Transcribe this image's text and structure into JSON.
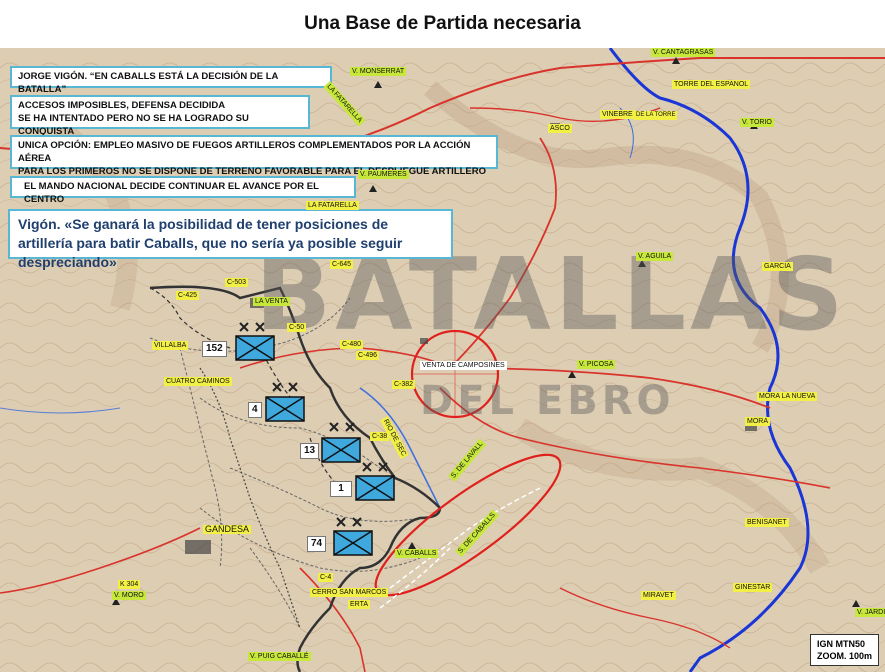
{
  "title": "Una Base de Partida necesaria",
  "info_boxes": {
    "vigon_quote_title": "JORGE VIGÓN. “EN CABALLS ESTÁ LA DECISIÓN DE LA BATALLA”",
    "accesos": "ACCESOS IMPOSIBLES, DEFENSA DECIDIDA\nSE HA INTENTADO PERO NO SE HA LOGRADO SU CONQUISTA",
    "unica_opcion": "UNICA OPCIÓN: EMPLEO MASIVO DE FUEGOS ARTILLEROS COMPLEMENTADOS POR LA ACCIÓN AÉREA\nPARA LOS PRIMEROS NO SE DISPONE DE TERRENO FAVORABLE PARA EL DESPLIEGUE ARTILLERO",
    "mando": "EL MANDO NACIONAL DECIDE CONTINUAR EL AVANCE POR EL CENTRO"
  },
  "quote": "Vigón. «Se ganará la posibilidad de tener posiciones de artillería para batir Caballs, que no sería ya posible seguir despreciando»",
  "watermark": {
    "line1": "BATALLAS",
    "line2": "DEL EBRO"
  },
  "units": [
    {
      "number": "152"
    },
    {
      "number": "4"
    },
    {
      "number": "13"
    },
    {
      "number": "1"
    },
    {
      "number": "74"
    }
  ],
  "place_labels": {
    "cantagrasas": "V. CANTAGRASAS",
    "monserrat": "V. MONSERRAT",
    "fatarella_top": "LA FATARELLA",
    "torre_espanol": "TORRE DEL ESPANOL",
    "vinebre": "VINEBRE",
    "torre": "DE LA TORRE",
    "torio": "V. TORIO",
    "asco": "ASCO",
    "paumeres": "V. PAUMERES",
    "la_fatarella": "LA FATARELLA",
    "aguila": "V. AGUILA",
    "garcia": "GARCIA",
    "c645": "C-645",
    "c503": "C-503",
    "c425": "C-425",
    "la_venta": "LA VENTA",
    "c507": "C-50",
    "c480": "C-480",
    "c496": "C-496",
    "villalba": "VILLALBA",
    "venta_camposines": "VENTA DE CAMPOSINES",
    "picosa": "V. PICOSA",
    "cuatro_caminos": "CUATRO CAMINOS",
    "c382": "C-382",
    "mora_nueva": "MORA LA NUEVA",
    "mora": "MORA",
    "rio_sec": "RIO DE SEC",
    "valls": "S. DE LAVALL",
    "caballs_sierra": "S. DE CABALLS",
    "caballs": "V. CABALLS",
    "benisanet": "BENISANET",
    "gandesa": "GANDESA",
    "k304": "K 304",
    "moro": "V. MORO",
    "cerro_san_marcos": "CERRO SAN MARCOS",
    "miravet": "MIRAVET",
    "ginestar": "GINESTAR",
    "erta": "ERTA",
    "puig": "V. PUIG CABALLÉ",
    "jardin": "V. JARDIN",
    "c4": "C-4",
    "c38": "C-38"
  },
  "scale": {
    "line1": "IGN MTN50",
    "line2": "ZOOM. 100m"
  },
  "colors": {
    "front_line": "#333333",
    "river": "#1a36d6",
    "road": "#d9332b",
    "circle": "#e0201c",
    "box_border": "#59b7d6",
    "unit_fill": "#3fa9de"
  }
}
